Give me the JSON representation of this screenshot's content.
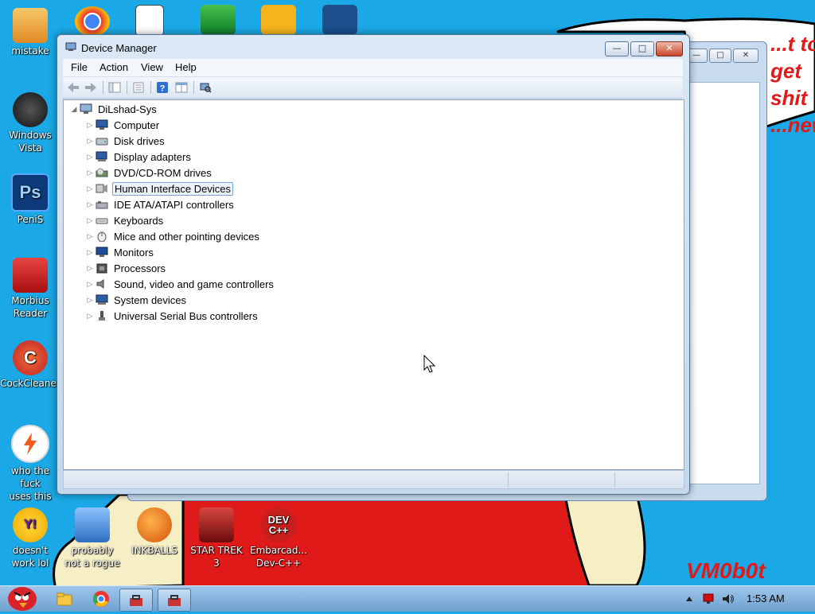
{
  "desktop": {
    "icons": [
      {
        "label": "mistake",
        "glyph": "",
        "color": "#f0a33a"
      },
      {
        "label": "Windows\nVista",
        "glyph": "",
        "color": "#222222"
      },
      {
        "label": "PeniS",
        "glyph": "Ps",
        "color": "#0d3a78"
      },
      {
        "label": "Morbius\nReader",
        "glyph": "",
        "color": "#d01a1a"
      },
      {
        "label": "CockCleaner",
        "glyph": "C",
        "color": "#d63c2a"
      },
      {
        "label": "who the fuck\nuses this",
        "glyph": "",
        "color": "#ffffff"
      },
      {
        "label": "doesn't\nwork lol",
        "glyph": "Y!",
        "color": "#6b1fa0"
      },
      {
        "label": "probably\nnot a rogue",
        "glyph": "",
        "color": "#4f8fd6"
      },
      {
        "label": "INKBALLS",
        "glyph": "",
        "color": "#f07a1a"
      },
      {
        "label": "STAR TREK\n3",
        "glyph": "",
        "color": "#a8211e"
      },
      {
        "label": "Embarcad...\nDev-C++",
        "glyph": "DEV\nC++",
        "color": "#c81e1e"
      }
    ],
    "watermark": "VM0b0t",
    "speech_text": [
      "...t to get shit",
      "...new"
    ]
  },
  "window": {
    "title": "Device Manager",
    "controls": {
      "minimize": "—",
      "maximize": "□",
      "close": "✕"
    },
    "menu": [
      "File",
      "Action",
      "View",
      "Help"
    ],
    "toolbar_icons": [
      "back-icon",
      "forward-icon",
      "show-hide-tree-icon",
      "properties-icon",
      "help-icon",
      "view-icon",
      "scan-hardware-icon"
    ]
  },
  "tree": {
    "root": "DiLshad-Sys",
    "selected_index": 4,
    "items": [
      {
        "label": "Computer",
        "icon": "computer-icon"
      },
      {
        "label": "Disk drives",
        "icon": "disk-drive-icon"
      },
      {
        "label": "Display adapters",
        "icon": "display-adapter-icon"
      },
      {
        "label": "DVD/CD-ROM drives",
        "icon": "dvd-drive-icon"
      },
      {
        "label": "Human Interface Devices",
        "icon": "hid-icon"
      },
      {
        "label": "IDE ATA/ATAPI controllers",
        "icon": "ide-controller-icon"
      },
      {
        "label": "Keyboards",
        "icon": "keyboard-icon"
      },
      {
        "label": "Mice and other pointing devices",
        "icon": "mouse-icon"
      },
      {
        "label": "Monitors",
        "icon": "monitor-icon"
      },
      {
        "label": "Processors",
        "icon": "processor-icon"
      },
      {
        "label": "Sound, video and game controllers",
        "icon": "sound-icon"
      },
      {
        "label": "System devices",
        "icon": "system-device-icon"
      },
      {
        "label": "Universal Serial Bus controllers",
        "icon": "usb-icon"
      }
    ]
  },
  "taskbar": {
    "clock": "1:53 AM",
    "tray_icons": [
      "show-hidden-icons-icon",
      "network-icon",
      "volume-icon"
    ]
  },
  "colors": {
    "wallpaper_blue": "#1aa9e6",
    "red_area": "#e01919",
    "sand": "#f6efc6",
    "selection_border": "#7da2ce"
  }
}
